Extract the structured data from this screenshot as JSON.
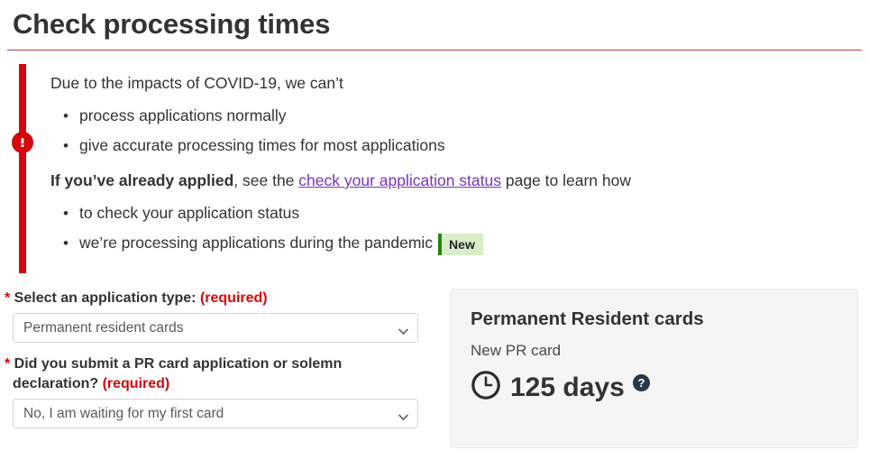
{
  "page": {
    "title": "Check processing times"
  },
  "alert": {
    "icon": "exclamation-circle-icon",
    "lead": "Due to the impacts of COVID-19, we can’t",
    "reasons": [
      "process applications normally",
      "give accurate processing times for most applications"
    ],
    "applied_strong": "If you’ve already applied",
    "applied_mid": ", see the ",
    "applied_link": "check your application status",
    "applied_tail": " page to learn how",
    "howto": [
      "to check your application status",
      "we’re processing applications during the pandemic"
    ],
    "badge": "New",
    "colors": {
      "bar": "#d3080c",
      "link": "#7834bc",
      "badge_bg": "#d8eeca",
      "badge_border": "#278400"
    }
  },
  "form": {
    "fields": [
      {
        "star": "*",
        "label": " Select an application type: ",
        "required": "(required)",
        "value": "Permanent resident cards",
        "options": [
          "Permanent resident cards"
        ]
      },
      {
        "star": "*",
        "label": " Did you submit a PR card application or solemn declaration? ",
        "required": "(required)",
        "value": "No, I am waiting for my first card",
        "options": [
          "No, I am waiting for my first card"
        ]
      }
    ]
  },
  "result": {
    "title": "Permanent Resident cards",
    "subtitle": "New PR card",
    "clock_icon": "clock-icon",
    "time": "125 days",
    "help_icon": "help-circle-icon",
    "colors": {
      "panel_bg": "#f5f5f5",
      "help": "#26374a"
    }
  }
}
